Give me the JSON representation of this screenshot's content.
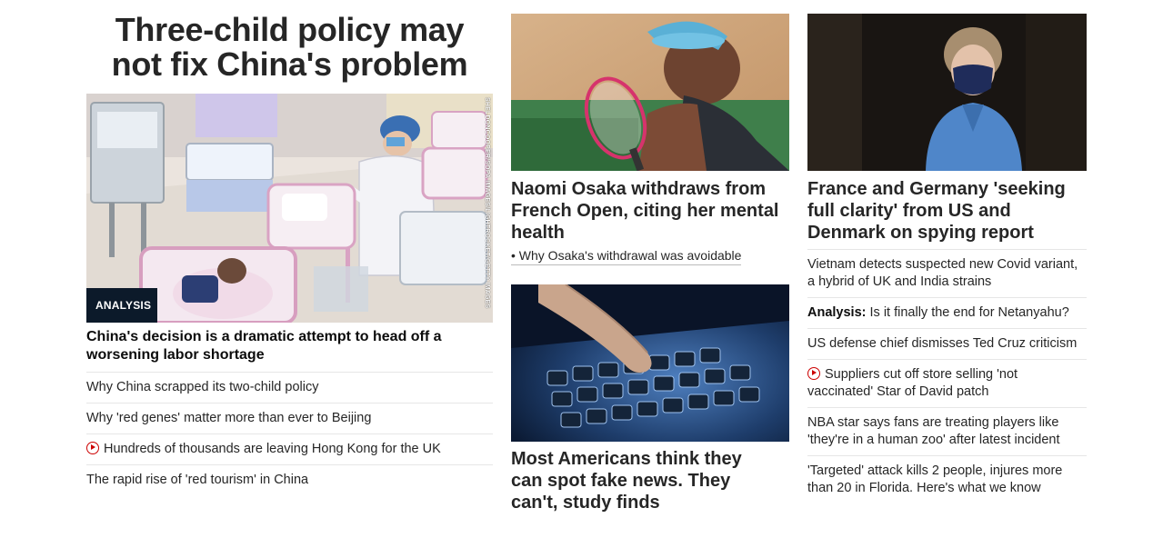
{
  "col1": {
    "headline": "Three-child policy may not fix China's problem",
    "badge": "ANALYSIS",
    "photo_credit": "SHELDONCOOPER/SOPA IMAGES/LIGHTROCKET/GETTY IMAGES",
    "subheadline": "China's decision is a dramatic attempt to head off a worsening labor shortage",
    "links": [
      {
        "text": "Why China scrapped its two-child policy",
        "video": false
      },
      {
        "text": "Why 'red genes' matter more than ever to Beijing",
        "video": false
      },
      {
        "text": "Hundreds of thousands are leaving Hong Kong for the UK",
        "video": true
      },
      {
        "text": "The rapid rise of 'red tourism' in China",
        "video": false
      }
    ]
  },
  "col2": {
    "story1": {
      "headline": "Naomi Osaka withdraws from French Open, citing her mental health",
      "related": "• Why Osaka's withdrawal was avoidable"
    },
    "story2": {
      "headline": "Most Americans think they can spot fake news. They can't, study finds"
    }
  },
  "col3": {
    "headline": "France and Germany 'seeking full clarity' from US and Denmark on spying report",
    "links": [
      {
        "text": "Vietnam detects suspected new Covid variant, a hybrid of UK and India strains",
        "prefix": "",
        "video": false
      },
      {
        "text": "Is it finally the end for Netanyahu?",
        "prefix": "Analysis:",
        "video": false
      },
      {
        "text": "US defense chief dismisses Ted Cruz criticism",
        "prefix": "",
        "video": false
      },
      {
        "text": "Suppliers cut off store selling 'not vaccinated' Star of David patch",
        "prefix": "",
        "video": true
      },
      {
        "text": "NBA star says fans are treating players like 'they're in a human zoo' after latest incident",
        "prefix": "",
        "video": false
      },
      {
        "text": "'Targeted' attack kills 2 people, injures more than 20 in Florida. Here's what we know",
        "prefix": "",
        "video": false
      }
    ]
  },
  "colors": {
    "video_red": "#cc0000",
    "badge_bg": "#0c1a2a",
    "divider": "#e6e6e6"
  }
}
